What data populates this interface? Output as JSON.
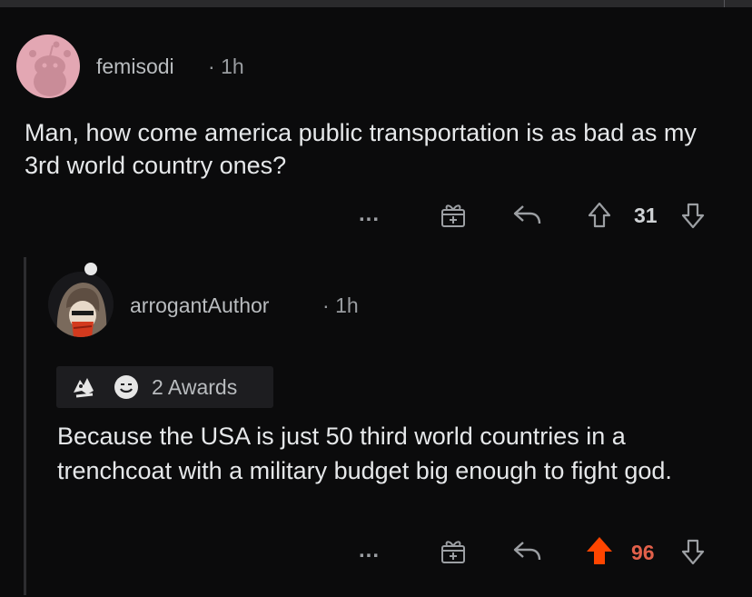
{
  "comments": [
    {
      "author": "femisodi",
      "time": "1h",
      "body": "Man, how come america public transportation is as bad as my 3rd world country ones?",
      "actions": {
        "more": "...",
        "score": "31"
      }
    },
    {
      "author": "arrogantAuthor",
      "time": "1h",
      "awards_label": "2 Awards",
      "body": "Because the USA is just 50 third world countries in a trenchcoat with a military budget big enough to fight god.",
      "actions": {
        "more": "...",
        "score": "96",
        "upvoted": true
      }
    }
  ],
  "separator": "·",
  "colors": {
    "upvote_active": "#ff4500",
    "score_active": "#e2604a",
    "avatar1_bg": "#e3a7b3"
  }
}
